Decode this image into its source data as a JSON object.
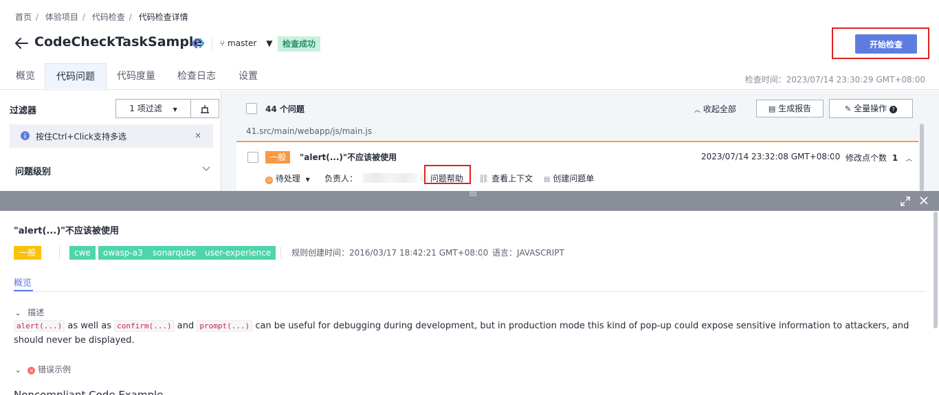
{
  "breadcrumb": [
    "首页",
    "体验项目",
    "代码检查",
    "代码检查详情"
  ],
  "breadcrumb_sep": "/",
  "header": {
    "title": "CodeCheckTaskSample",
    "branch": "master",
    "status": "检查成功",
    "start_button": "开始检查"
  },
  "tabs": [
    "概览",
    "代码问题",
    "代码度量",
    "检查日志",
    "设置"
  ],
  "active_tab": "代码问题",
  "check_time": "检查时间：2023/07/14 23:30:29 GMT+08:00",
  "filter": {
    "title": "过滤器",
    "filter_button": "1 项过滤",
    "tip": "按住Ctrl+Click支持多选",
    "close": "×",
    "level_label": "问题级别"
  },
  "issues": {
    "count": "44 个问题",
    "collapse_all": "收起全部",
    "generate_report": "生成报告",
    "bulk_ops": "全量操作",
    "file_path": "41.src/main/webapp/js/main.js",
    "item": {
      "severity": "一般",
      "title": "\"alert(...)\"不应该被使用",
      "time": "2023/07/14 23:32:08 GMT+08:00",
      "mod_label": "修改点个数",
      "mod_count": "1",
      "status": "待处理",
      "assignee_label": "负责人：",
      "help": "问题帮助",
      "context": "查看上下文",
      "create_issue": "创建问题单"
    }
  },
  "drawer": {
    "title": "\"alert(...)\"不应该被使用",
    "severity": "一般",
    "tags": [
      "cwe",
      "owasp-a3",
      "sonarqube",
      "user-experience"
    ],
    "rule_created": "规则创建时间：2016/03/17 18:42:21 GMT+08:00",
    "language": "语言：JAVASCRIPT",
    "sub_tab": "概览",
    "desc_heading": "描述",
    "desc": {
      "code1": "alert(...)",
      "t1": " as well as ",
      "code2": "confirm(...)",
      "t2": " and ",
      "code3": "prompt(...)",
      "t3": " can be useful for debugging during development, but in production mode this kind of pop-up could expose sensitive information to attackers, and should never be displayed."
    },
    "error_example": "错误示例",
    "noncompliant": "Noncompliant Code Example"
  },
  "colors": {
    "accent": "#5e7ce0",
    "orange": "#fa9841",
    "yellow": "#fac20a",
    "green": "#50d4ab",
    "highlight": "#e02020"
  }
}
